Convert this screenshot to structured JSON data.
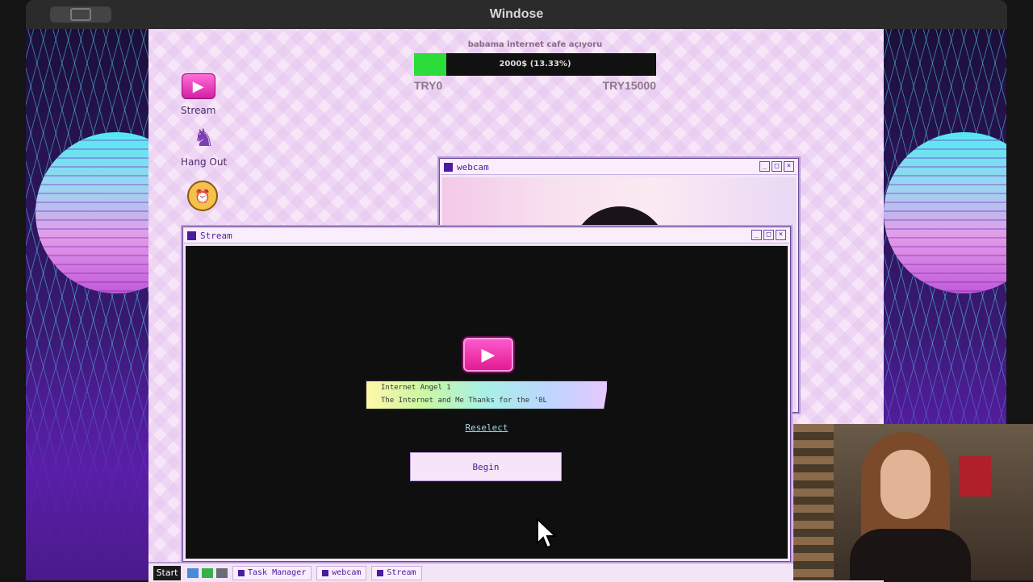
{
  "app": {
    "title": "Windose"
  },
  "desktop_icons": [
    {
      "label": "Stream"
    },
    {
      "label": "Hang Out"
    }
  ],
  "progress": {
    "title": "babama internet cafe açıyoru",
    "text": "2000$ (13.33%)",
    "fraction": 0.1333,
    "min_label": "TRY0",
    "max_label": "TRY15000",
    "fill_color": "#2bdc3a"
  },
  "webcam_window": {
    "title": "webcam"
  },
  "stream_window": {
    "title": "Stream",
    "card_line1": "Internet Angel 1",
    "card_line2": "The Internet and Me  Thanks for the '0L",
    "reselect_label": "Reselect",
    "begin_label": "Begin"
  },
  "taskbar": {
    "start_label": "Start",
    "items": [
      {
        "label": "Task Manager"
      },
      {
        "label": "webcam"
      },
      {
        "label": "Stream"
      }
    ]
  },
  "colors": {
    "accent": "#4a1aa0",
    "window_border": "#b89bd8",
    "desktop_bg": "#f7e6f8"
  }
}
